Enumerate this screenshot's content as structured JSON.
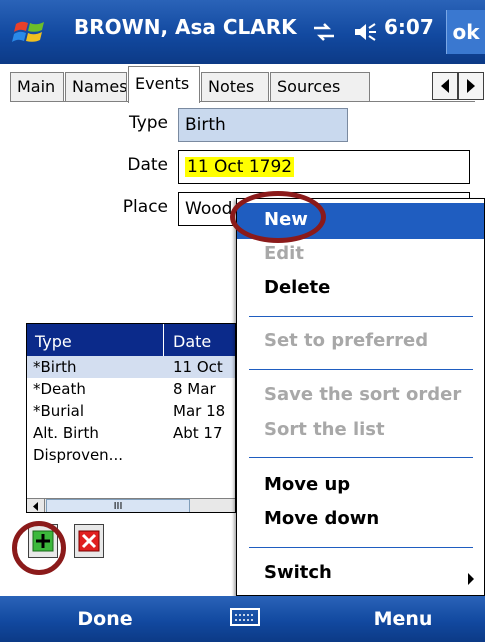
{
  "titlebar": {
    "title": "BROWN, Asa CLARK",
    "time": "6:07",
    "ok_label": "ok",
    "icons": [
      "windows-start-icon",
      "connectivity-icon",
      "volume-icon"
    ]
  },
  "tabs": [
    {
      "label": "Main",
      "active": false
    },
    {
      "label": "Names",
      "active": false
    },
    {
      "label": "Events",
      "active": true
    },
    {
      "label": "Notes",
      "active": false
    },
    {
      "label": "Sources",
      "active": false
    }
  ],
  "form": {
    "type_label": "Type",
    "type_value": "Birth",
    "date_label": "Date",
    "date_value": "11 Oct 1792",
    "place_label": "Place",
    "place_value": "Wood"
  },
  "events_table": {
    "columns": [
      "Type",
      "Date"
    ],
    "rows": [
      {
        "type": "*Birth",
        "date": "11 Oct"
      },
      {
        "type": "*Death",
        "date": "8 Mar"
      },
      {
        "type": "*Burial",
        "date": "Mar 18"
      },
      {
        "type": "Alt. Birth",
        "date": "Abt 17"
      },
      {
        "type": "Disproven...",
        "date": ""
      }
    ],
    "scroll_thumb": "III"
  },
  "context_menu": {
    "items": [
      {
        "label": "New",
        "state": "highlighted"
      },
      {
        "label": "Edit",
        "state": "disabled"
      },
      {
        "label": "Delete",
        "state": "enabled"
      },
      {
        "label": "Set to preferred",
        "state": "disabled"
      },
      {
        "label": "Save the sort order",
        "state": "disabled"
      },
      {
        "label": "Sort the list",
        "state": "disabled"
      },
      {
        "label": "Move up",
        "state": "enabled"
      },
      {
        "label": "Move down",
        "state": "enabled"
      },
      {
        "label": "Switch",
        "state": "enabled"
      }
    ]
  },
  "softkeys": {
    "left": "Done",
    "right": "Menu"
  },
  "colors": {
    "titlebar_blue": "#1249a0",
    "menu_highlight": "#1f5dc0",
    "date_highlight": "#ffff00",
    "annotation_red": "#8b1a1a",
    "table_header": "#0b2a8a"
  }
}
